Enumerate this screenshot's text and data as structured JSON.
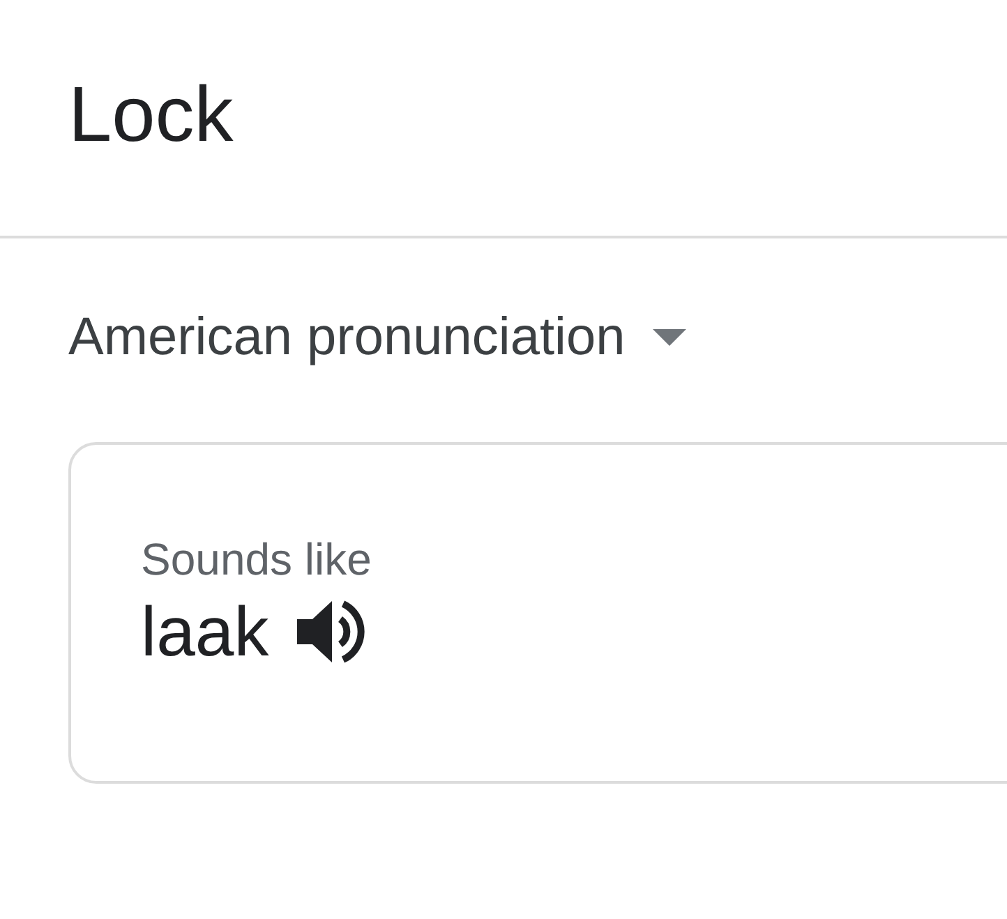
{
  "title": "Lock",
  "accent_selector": {
    "label": "American pronunciation"
  },
  "card": {
    "caption": "Sounds like",
    "pronunciation": "laak"
  }
}
